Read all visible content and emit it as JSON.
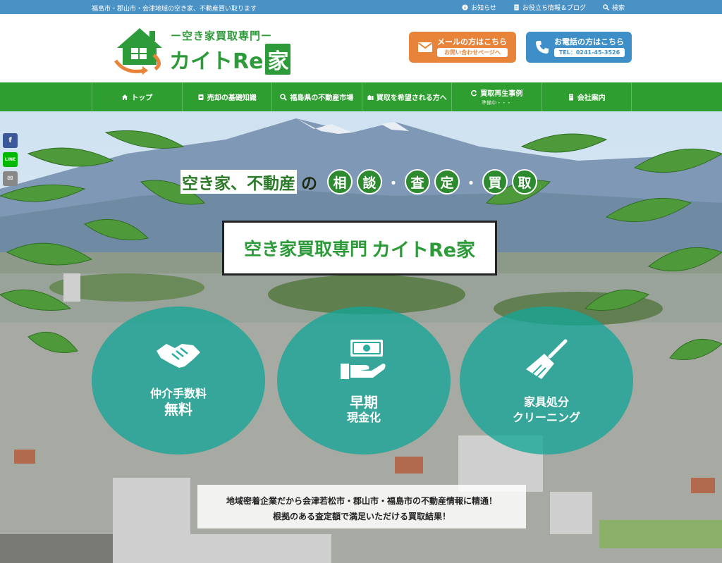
{
  "topbar": {
    "tagline": "福島市・郡山市・会津地域の空き家、不動産買い取ります",
    "links": [
      {
        "label": "お知らせ",
        "icon": "info-icon"
      },
      {
        "label": "お役立ち情報＆ブログ",
        "icon": "document-icon"
      },
      {
        "label": "検索",
        "icon": "search-icon"
      }
    ]
  },
  "logo": {
    "tagline": "ー空き家買取専門ー",
    "brand_text": "カイトRe",
    "brand_box": "家"
  },
  "cta": {
    "mail": {
      "title": "メールの方はこちら",
      "sub": "お問い合わせページへ",
      "icon": "envelope-icon"
    },
    "tel": {
      "title": "お電話の方はこちら",
      "sub": "TEL：0241-45-3526",
      "icon": "phone-icon"
    }
  },
  "nav": {
    "items": [
      {
        "label": "トップ",
        "icon": "home-icon"
      },
      {
        "label": "売却の基礎知識",
        "icon": "book-icon"
      },
      {
        "label": "福島県の不動産市場",
        "icon": "search-icon"
      },
      {
        "label": "買取を希望される方へ",
        "icon": "house-icon"
      },
      {
        "label": "買取再生事例",
        "sub": "準備中・・・",
        "icon": "refresh-icon"
      },
      {
        "label": "会社案内",
        "icon": "building-icon"
      }
    ]
  },
  "hero": {
    "headline_a": "空き家、不動産",
    "headline_no": "の",
    "headline_chars": [
      "相",
      "談",
      "査",
      "定",
      "買",
      "取"
    ],
    "headline_sep": "・",
    "title_a": "空き家買取専門",
    "title_b": "カイトRe家",
    "features": [
      {
        "line1": "仲介手数料",
        "line2": "無料",
        "icon": "handshake-icon"
      },
      {
        "line1": "早期",
        "line2": "現金化",
        "icon": "money-hand-icon"
      },
      {
        "line1": "家具処分",
        "line2": "クリーニング",
        "icon": "broom-icon"
      }
    ],
    "note_line1": "地域密着企業だから会津若松市・郡山市・福島市の不動産情報に精通！",
    "note_line2": "根拠のある査定額で満足いただける買取結果！"
  },
  "share": [
    {
      "label": "f",
      "name": "facebook-share-button",
      "color": "#3b5998"
    },
    {
      "label": "LINE",
      "name": "line-share-button",
      "color": "#00b900"
    },
    {
      "label": "✉",
      "name": "email-share-button",
      "color": "#888888"
    }
  ]
}
